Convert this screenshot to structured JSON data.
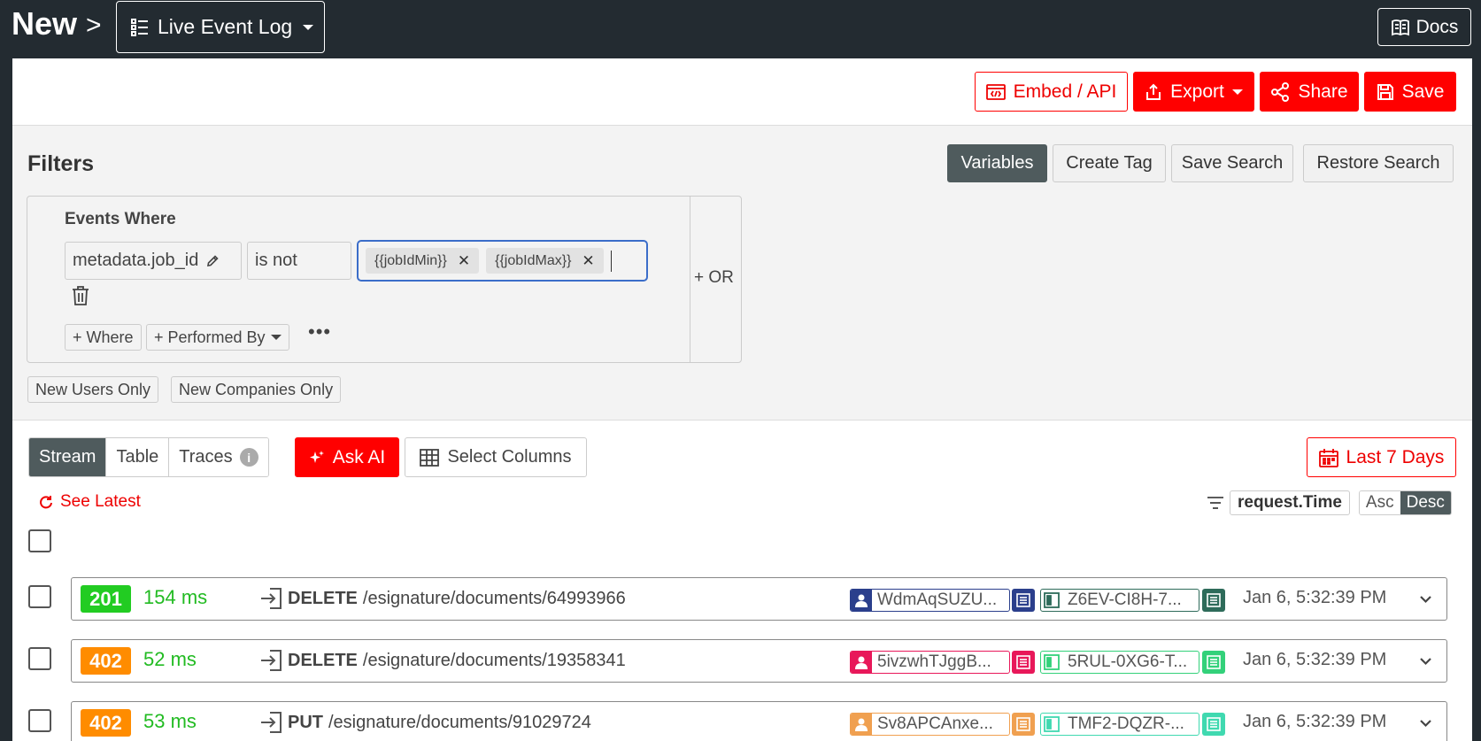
{
  "header": {
    "breadcrumb_root": "New",
    "breadcrumb_sep": ">",
    "view_label": "Live Event Log",
    "docs_label": "Docs"
  },
  "actions": {
    "embed": "Embed / API",
    "export": "Export",
    "share": "Share",
    "save": "Save"
  },
  "filters": {
    "title": "Filters",
    "buttons": [
      "Variables",
      "Create Tag",
      "Save Search",
      "Restore Search"
    ],
    "events_where": "Events Where",
    "field": "metadata.job_id",
    "operator": "is not",
    "values": [
      "{{jobIdMin}}",
      "{{jobIdMax}}"
    ],
    "add_where": "+ Where",
    "add_performed_by": "+ Performed By",
    "or_label": "+ OR",
    "quick": [
      "New Users Only",
      "New Companies Only"
    ]
  },
  "stream": {
    "views": [
      "Stream",
      "Table",
      "Traces"
    ],
    "active_view": "Stream",
    "ask_ai": "Ask AI",
    "select_columns": "Select Columns",
    "date_range": "Last 7 Days",
    "see_latest": "See Latest",
    "sort_field": "request.Time",
    "sort_asc": "Asc",
    "sort_desc": "Desc",
    "sort_active": "Desc"
  },
  "rows": [
    {
      "status": "201",
      "status_color": "#22cc22",
      "latency": "154 ms",
      "method": "DELETE",
      "path": "/esignature/documents/64993966",
      "user": "WdmAqSUZU...",
      "user_color": "#2b3f8c",
      "company": "Z6EV-CI8H-7...",
      "company_color": "#2e6b5a",
      "time": "Jan 6, 5:32:39 PM"
    },
    {
      "status": "402",
      "status_color": "#ff8c00",
      "latency": "52 ms",
      "method": "DELETE",
      "path": "/esignature/documents/19358341",
      "user": "5ivzwhTJggB...",
      "user_color": "#e8185a",
      "company": "5RUL-0XG6-T...",
      "company_color": "#33d17a",
      "time": "Jan 6, 5:32:39 PM"
    },
    {
      "status": "402",
      "status_color": "#ff8c00",
      "latency": "53 ms",
      "method": "PUT",
      "path": "/esignature/documents/91029724",
      "user": "Sv8APCAnxe...",
      "user_color": "#f0a050",
      "company": "TMF2-DQZR-...",
      "company_color": "#40d9b0",
      "time": "Jan 6, 5:32:39 PM"
    }
  ]
}
